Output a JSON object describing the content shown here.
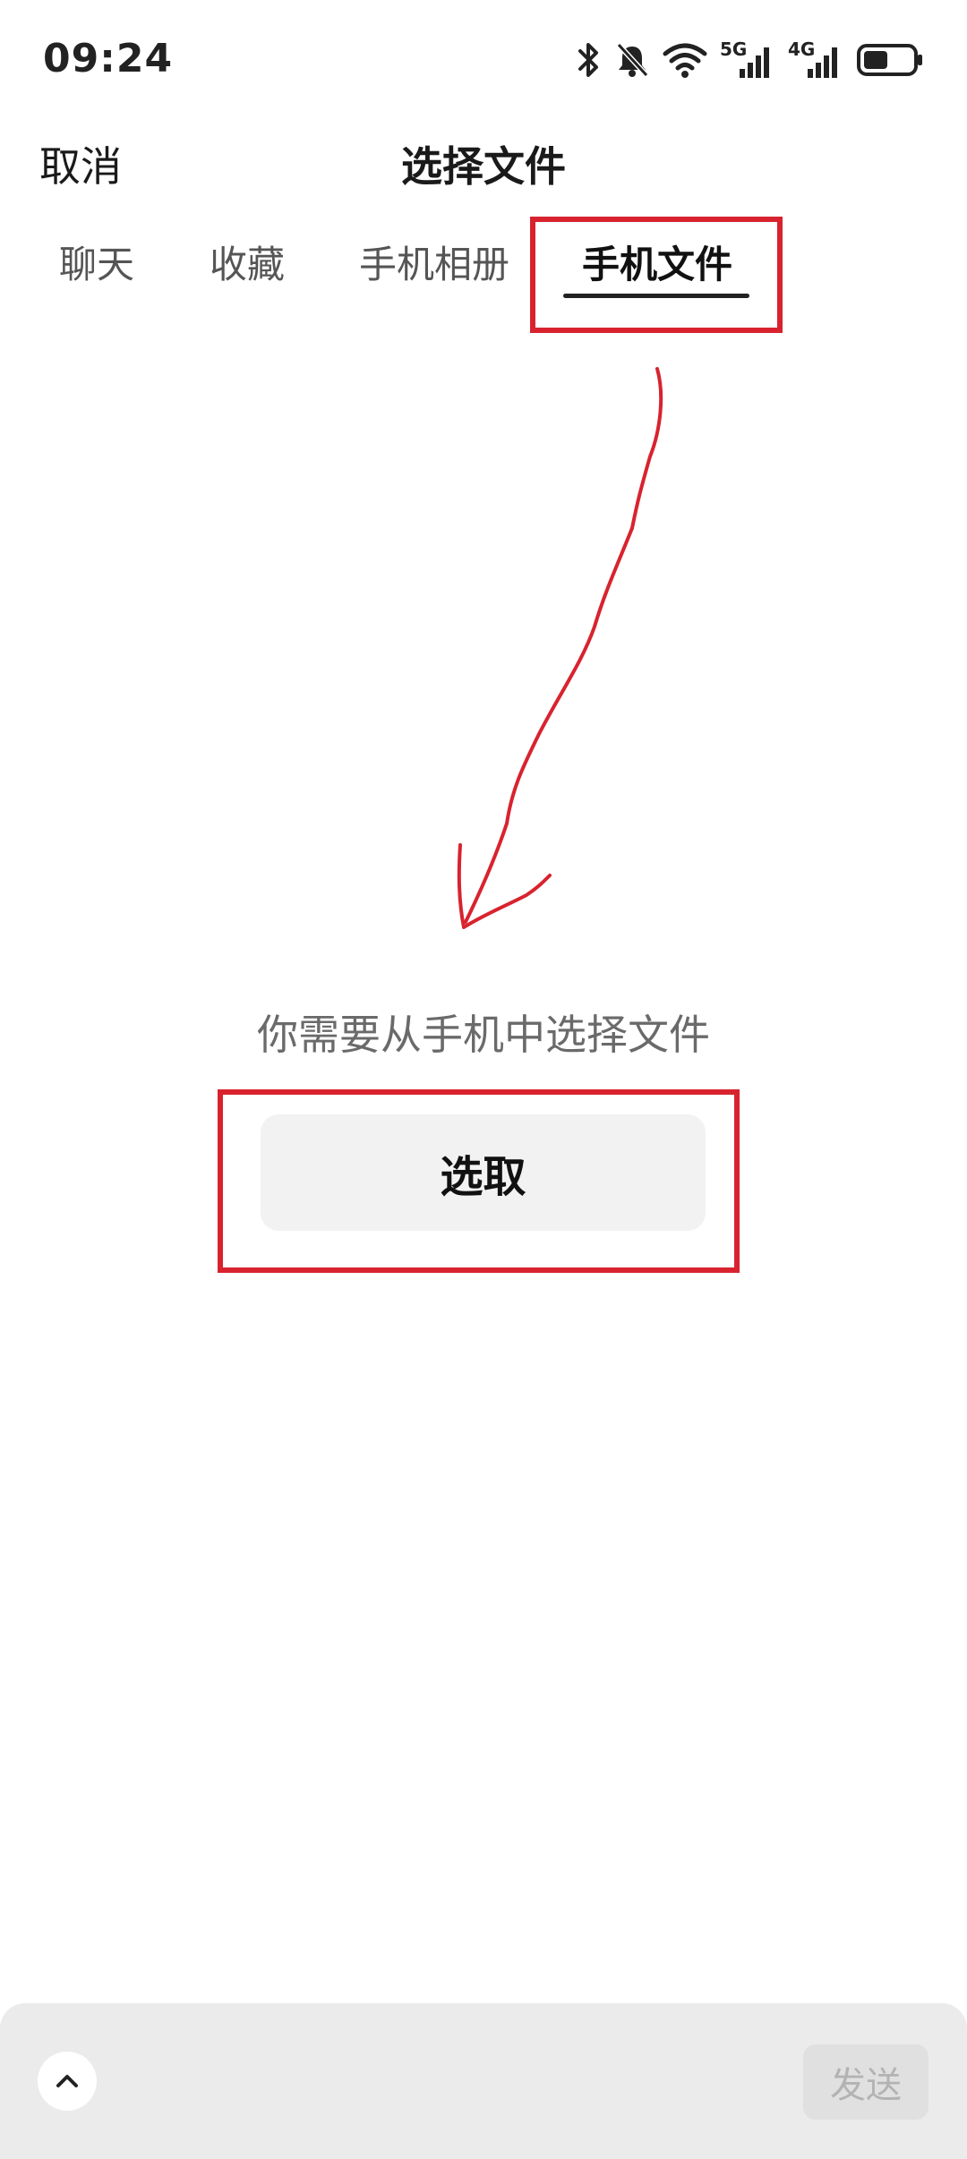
{
  "status_bar": {
    "time": "09:24",
    "icons": [
      "bluetooth-icon",
      "bell-muted-icon",
      "wifi-icon",
      "signal-5g-icon",
      "signal-4g-icon",
      "battery-icon"
    ],
    "net1": "5G",
    "net2": "4G",
    "battery_level": 0.5
  },
  "header": {
    "cancel_label": "取消",
    "title": "选择文件"
  },
  "tabs": [
    {
      "label": "聊天",
      "active": false
    },
    {
      "label": "收藏",
      "active": false
    },
    {
      "label": "手机相册",
      "active": false
    },
    {
      "label": "手机文件",
      "active": true
    }
  ],
  "content": {
    "prompt": "你需要从手机中选择文件",
    "pick_button_label": "选取"
  },
  "bottom_bar": {
    "send_label": "发送"
  },
  "colors": {
    "annotation": "#d8232f",
    "background": "#ffffff",
    "bottom_bar": "#ebebeb"
  }
}
